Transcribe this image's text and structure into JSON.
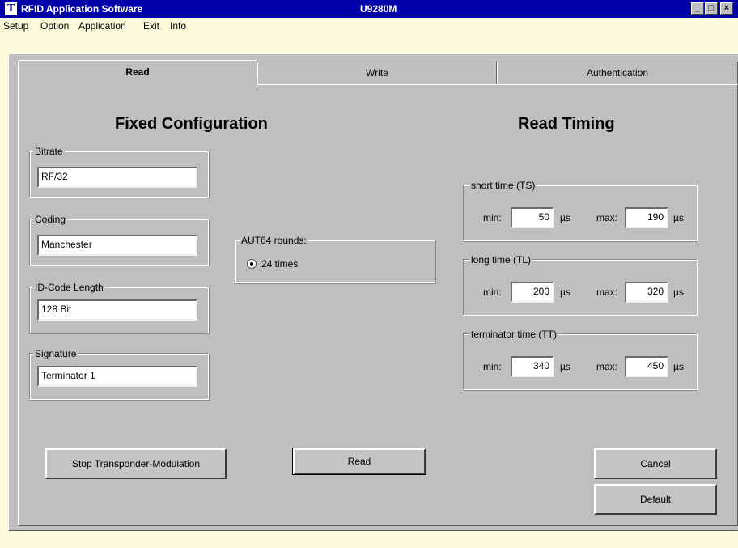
{
  "window": {
    "title": "RFID Application Software",
    "subtitle": "U9280M",
    "app_icon_glyph": "T",
    "controls": [
      "_",
      "□",
      "×"
    ]
  },
  "menu": [
    "Setup",
    "Option",
    "Application",
    "Exit",
    "Info"
  ],
  "tabs": [
    {
      "label": "Read",
      "active": true
    },
    {
      "label": "Write",
      "active": false
    },
    {
      "label": "Authentication",
      "active": false
    }
  ],
  "fixed_config": {
    "heading": "Fixed Configuration",
    "bitrate": {
      "label": "Bitrate",
      "value": "RF/32"
    },
    "coding": {
      "label": "Coding",
      "value": "Manchester"
    },
    "id_code_length": {
      "label": "ID-Code Length",
      "value": "128 Bit"
    },
    "signature": {
      "label": "Signature",
      "value": "Terminator 1"
    }
  },
  "aut64": {
    "label": "AUT64 rounds:",
    "option": "24 times",
    "selected": true
  },
  "read_timing": {
    "heading": "Read Timing",
    "short": {
      "label": "short time (TS)",
      "min": "50",
      "max": "190"
    },
    "long": {
      "label": "long time (TL)",
      "min": "200",
      "max": "320"
    },
    "terminator": {
      "label": "terminator time (TT)",
      "min": "340",
      "max": "450"
    },
    "min_label": "min:",
    "max_label": "max:",
    "unit": "µs"
  },
  "buttons": {
    "stop": "Stop Transponder-Modulation",
    "read": "Read",
    "cancel": "Cancel",
    "default": "Default"
  }
}
